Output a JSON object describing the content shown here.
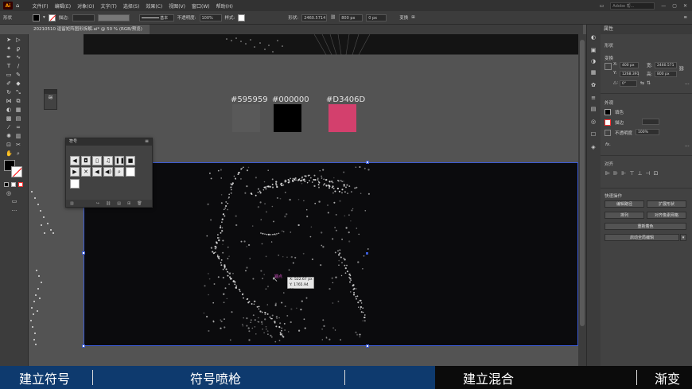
{
  "app": {
    "logo": "Ai",
    "accent": "#ff9a00"
  },
  "menubar": {
    "items": [
      "文件(F)",
      "编辑(E)",
      "对象(O)",
      "文字(T)",
      "选择(S)",
      "效果(C)",
      "视图(V)",
      "窗口(W)",
      "帮助(H)"
    ],
    "search_placeholder": "Adobe 帮..."
  },
  "controlbar": {
    "label": "形状",
    "stroke_label": "描边:",
    "stroke_style": "基本",
    "opacity_label": "不透明度:",
    "opacity_value": "100%",
    "style_label": "样式:",
    "shape_label": "形状:",
    "width_value": "2460.5714",
    "height_value": "800 px",
    "offset_value": "0 px",
    "transform_label": "变换"
  },
  "document_tab": {
    "title": "20210510 逗留矩阵图形拆解.ai* @ 50 % (RGB/预览)"
  },
  "swatches": [
    {
      "hex": "#595959",
      "color": "#595959"
    },
    {
      "hex": "#000000",
      "color": "#000000"
    },
    {
      "hex": "#D3406D",
      "color": "#D3406D"
    }
  ],
  "symbols_panel": {
    "title": "符号",
    "icons": [
      "arrow-left-icon",
      "camera-icon",
      "phone-icon",
      "music-icon",
      "pause-icon",
      "stop-icon",
      "play-icon",
      "mute-icon",
      "speaker-icon",
      "volume-icon",
      "search-icon",
      "blank-icon"
    ]
  },
  "cursor_tooltip": {
    "line1": "X: 522.67 px",
    "line2": "Y: 1765.94 px",
    "anchor_label": "锚点"
  },
  "properties_panel": {
    "tab": "属性",
    "shape_section": "形状",
    "transform_section": "变换",
    "x_label": "X:",
    "x_value": "400 px",
    "y_label": "Y:",
    "y_value": "1268.391",
    "w_label": "宽:",
    "w_value": "2460.571",
    "h_label": "高:",
    "h_value": "800 px",
    "angle_label": "△:",
    "angle_value": "0°",
    "appearance_section": "外观",
    "fill_label": "填色",
    "stroke_label": "描边",
    "opacity_label": "不透明度",
    "opacity_value": "100%",
    "fx_label": "fx.",
    "align_section": "对齐",
    "quick_actions_section": "快速操作",
    "btn_edit_symbol": "编辑路径",
    "btn_expand": "扩展形状",
    "btn_arrange": "排列",
    "btn_pixel_grid": "对齐像素网格",
    "btn_recolor": "重新着色",
    "btn_global_edit": "启动全局编辑"
  },
  "captions": [
    {
      "text": "建立符号",
      "bg": "#0e3a6e"
    },
    {
      "text": "符号喷枪",
      "bg": "#0e3a6e"
    },
    {
      "text": "建立混合",
      "bg": "#0b0b0b"
    },
    {
      "text": "渐变",
      "bg": "#0b0b0b"
    }
  ]
}
